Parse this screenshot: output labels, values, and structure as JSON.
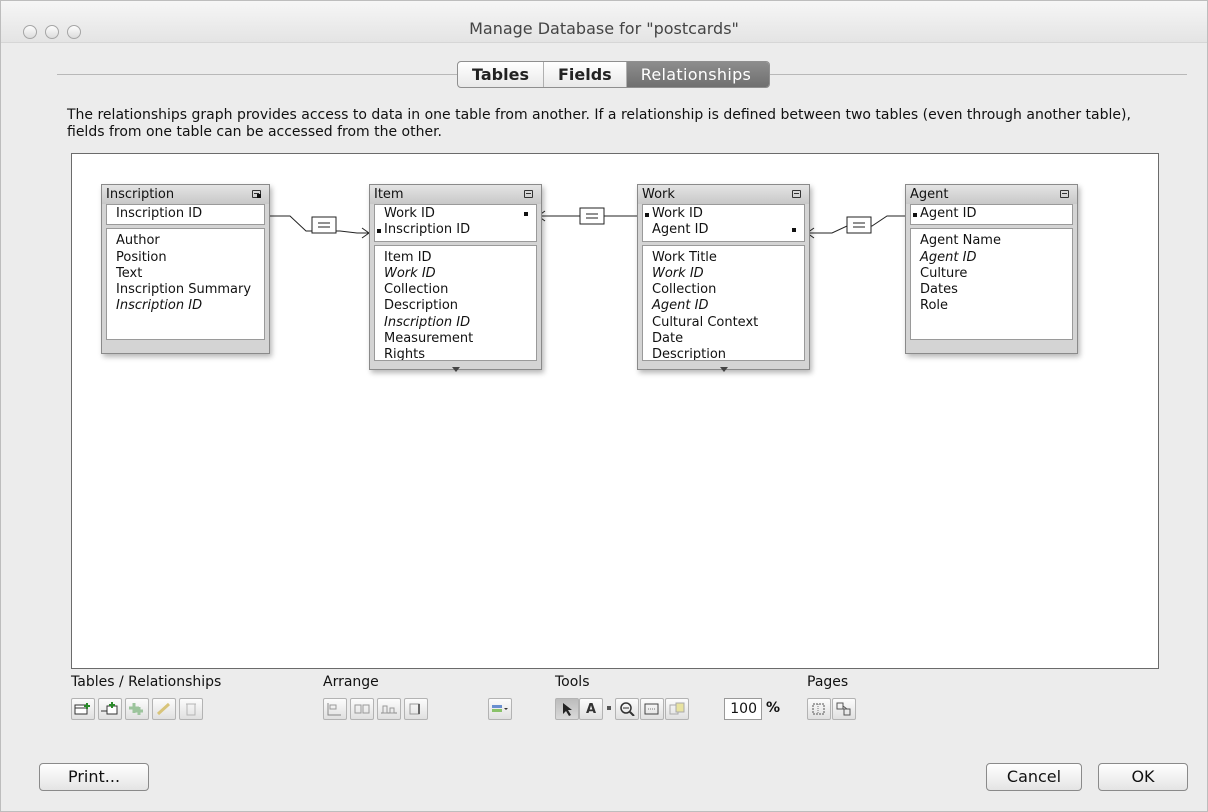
{
  "window": {
    "title": "Manage Database for \"postcards\""
  },
  "tabs": [
    {
      "label": "Tables",
      "active": false
    },
    {
      "label": "Fields",
      "active": false
    },
    {
      "label": "Relationships",
      "active": true
    }
  ],
  "description": "The relationships graph provides access to data in one table from another. If a relationship is defined between two tables (even through another table), fields from one table can be accessed from the other.",
  "tables": {
    "inscription": {
      "name": "Inscription",
      "keys": [
        "Inscription ID"
      ],
      "fields": [
        "Author",
        "Position",
        "Text",
        "Inscription Summary",
        "Inscription ID"
      ]
    },
    "item": {
      "name": "Item",
      "keys": [
        "Work ID",
        "Inscription ID"
      ],
      "fields": [
        "Item ID",
        "Work ID",
        "Collection",
        "Description",
        "Inscription ID",
        "Measurement",
        "Rights"
      ]
    },
    "work": {
      "name": "Work",
      "keys": [
        "Work ID",
        "Agent ID"
      ],
      "fields": [
        "Work Title",
        "Work ID",
        "Collection",
        "Agent ID",
        "Cultural Context",
        "Date",
        "Description"
      ]
    },
    "agent": {
      "name": "Agent",
      "keys": [
        "Agent ID"
      ],
      "fields": [
        "Agent Name",
        "Agent ID",
        "Culture",
        "Dates",
        "Role"
      ]
    }
  },
  "toolbar": {
    "tables_relationships_label": "Tables / Relationships",
    "arrange_label": "Arrange",
    "tools_label": "Tools",
    "pages_label": "Pages",
    "zoom_value": "100",
    "zoom_unit": "%",
    "tool_text_glyph": "A",
    "icons": {
      "tables_relationships": [
        "add-table-icon",
        "add-relationship-icon",
        "duplicate-icon",
        "edit-icon",
        "delete-icon"
      ],
      "arrange": [
        "align-left-icon",
        "align-center-icon",
        "align-bottom-icon",
        "resize-icon"
      ],
      "color": "color-palette-icon",
      "tools": [
        "select-pointer-icon",
        "text-tool-icon",
        "zoom-out-icon",
        "zoom-to-fit-icon",
        "page-breaks-icon"
      ],
      "pages": [
        "page-setup-icon",
        "show-page-breaks-icon"
      ]
    }
  },
  "buttons": {
    "print": "Print...",
    "cancel": "Cancel",
    "ok": "OK"
  }
}
